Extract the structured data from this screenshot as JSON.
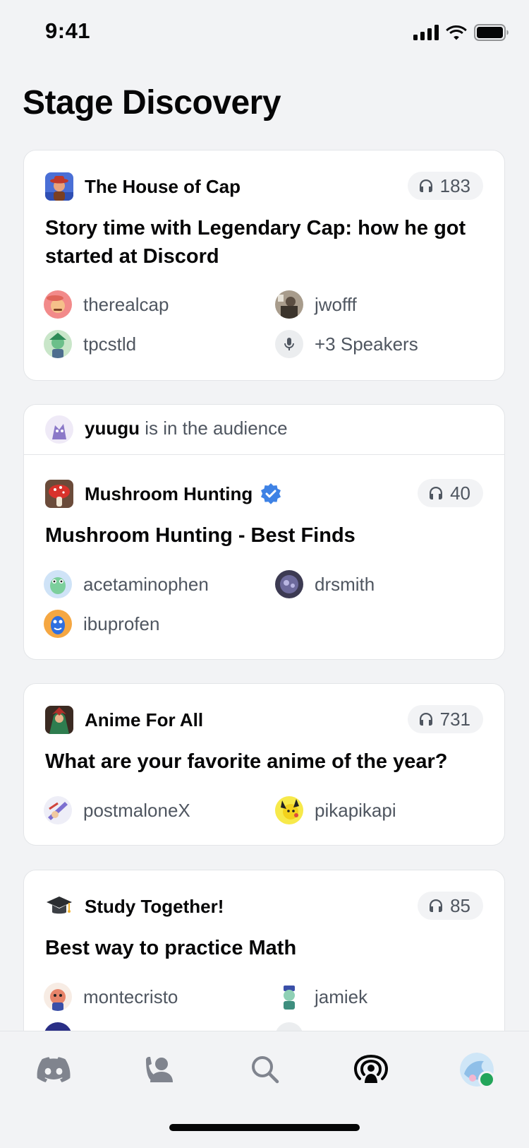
{
  "status": {
    "time": "9:41"
  },
  "page": {
    "title": "Stage Discovery"
  },
  "cards": [
    {
      "server": "The House of Cap",
      "listeners": "183",
      "topic": "Story time with Legendary Cap: how he got started at Discord",
      "speakers": [
        "therealcap",
        "jwofff",
        "tpcstld"
      ],
      "more_speakers": "+3 Speakers"
    },
    {
      "audience_user": "yuugu",
      "audience_text": " is in the audience",
      "server": "Mushroom Hunting",
      "verified": true,
      "listeners": "40",
      "topic": "Mushroom Hunting - Best Finds",
      "speakers": [
        "acetaminophen",
        "drsmith",
        "ibuprofen"
      ]
    },
    {
      "server": "Anime For All",
      "listeners": "731",
      "topic": "What are your favorite anime of the year?",
      "speakers": [
        "postmaloneX",
        "pikapikapi"
      ]
    },
    {
      "server": "Study Together!",
      "listeners": "85",
      "topic": "Best way to practice Math",
      "speakers": [
        "montecristo",
        "jamiek"
      ]
    }
  ],
  "tabs": [
    "home-tab",
    "friends-tab",
    "search-tab",
    "stage-discovery-tab",
    "profile-tab"
  ],
  "colors": {
    "accent": "#5865f2",
    "verified": "#3e82e5",
    "online": "#23a55a",
    "muted_text": "#4f5660"
  }
}
